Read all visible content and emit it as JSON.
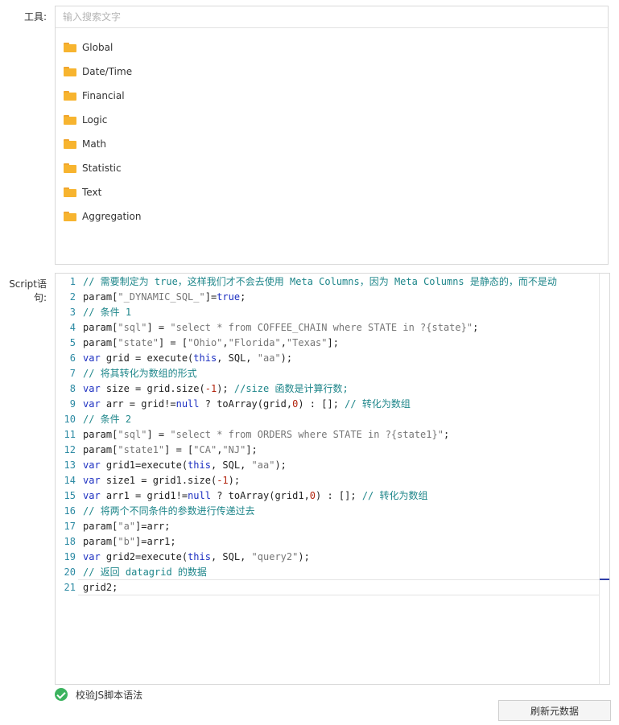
{
  "tools": {
    "label": "工具:",
    "search_placeholder": "输入搜索文字",
    "folders": [
      "Global",
      "Date/Time",
      "Financial",
      "Logic",
      "Math",
      "Statistic",
      "Text",
      "Aggregation"
    ]
  },
  "script": {
    "label": "Script语句:",
    "lines": [
      [
        [
          "cmt",
          "// 需要制定为 true，这样我们才不会去使用 Meta Columns，因为 Meta Columns 是静态的，而不是动"
        ]
      ],
      [
        [
          "p",
          "param["
        ],
        [
          "str",
          "\"_DYNAMIC_SQL_\""
        ],
        [
          "p",
          "]="
        ],
        [
          "kw",
          "true"
        ],
        [
          "p",
          ";"
        ]
      ],
      [
        [
          "cmt",
          "// 条件 1"
        ]
      ],
      [
        [
          "p",
          "param["
        ],
        [
          "str",
          "\"sql\""
        ],
        [
          "p",
          "] = "
        ],
        [
          "str",
          "\"select * from COFFEE_CHAIN where STATE in ?{state}\""
        ],
        [
          "p",
          ";"
        ]
      ],
      [
        [
          "p",
          "param["
        ],
        [
          "str",
          "\"state\""
        ],
        [
          "p",
          "] = ["
        ],
        [
          "str",
          "\"Ohio\""
        ],
        [
          "p",
          ","
        ],
        [
          "str",
          "\"Florida\""
        ],
        [
          "p",
          ","
        ],
        [
          "str",
          "\"Texas\""
        ],
        [
          "p",
          "];"
        ]
      ],
      [
        [
          "kw",
          "var"
        ],
        [
          "p",
          " grid = execute("
        ],
        [
          "kw",
          "this"
        ],
        [
          "p",
          ", SQL, "
        ],
        [
          "str",
          "\"aa\""
        ],
        [
          "p",
          ");"
        ]
      ],
      [
        [
          "cmt",
          "// 将其转化为数组的形式"
        ]
      ],
      [
        [
          "kw",
          "var"
        ],
        [
          "p",
          " size = grid.size("
        ],
        [
          "num",
          "-1"
        ],
        [
          "p",
          "); "
        ],
        [
          "cmt",
          "//size 函数是计算行数;"
        ]
      ],
      [
        [
          "kw",
          "var"
        ],
        [
          "p",
          " arr = grid!="
        ],
        [
          "kw",
          "null"
        ],
        [
          "p",
          " ? toArray(grid,"
        ],
        [
          "num",
          "0"
        ],
        [
          "p",
          ") : []; "
        ],
        [
          "cmt",
          "// 转化为数组"
        ]
      ],
      [
        [
          "cmt",
          "// 条件 2"
        ]
      ],
      [
        [
          "p",
          "param["
        ],
        [
          "str",
          "\"sql\""
        ],
        [
          "p",
          "] = "
        ],
        [
          "str",
          "\"select * from ORDERS where STATE in ?{state1}\""
        ],
        [
          "p",
          ";"
        ]
      ],
      [
        [
          "p",
          "param["
        ],
        [
          "str",
          "\"state1\""
        ],
        [
          "p",
          "] = ["
        ],
        [
          "str",
          "\"CA\""
        ],
        [
          "p",
          ","
        ],
        [
          "str",
          "\"NJ\""
        ],
        [
          "p",
          "];"
        ]
      ],
      [
        [
          "kw",
          "var"
        ],
        [
          "p",
          " grid1=execute("
        ],
        [
          "kw",
          "this"
        ],
        [
          "p",
          ", SQL, "
        ],
        [
          "str",
          "\"aa\""
        ],
        [
          "p",
          ");"
        ]
      ],
      [
        [
          "kw",
          "var"
        ],
        [
          "p",
          " size1 = grid1.size("
        ],
        [
          "num",
          "-1"
        ],
        [
          "p",
          ");"
        ]
      ],
      [
        [
          "kw",
          "var"
        ],
        [
          "p",
          " arr1 = grid1!="
        ],
        [
          "kw",
          "null"
        ],
        [
          "p",
          " ? toArray(grid1,"
        ],
        [
          "num",
          "0"
        ],
        [
          "p",
          ") : []; "
        ],
        [
          "cmt",
          "// 转化为数组"
        ]
      ],
      [
        [
          "cmt",
          "// 将两个不同条件的参数进行传递过去"
        ]
      ],
      [
        [
          "p",
          "param["
        ],
        [
          "str",
          "\"a\""
        ],
        [
          "p",
          "]=arr;"
        ]
      ],
      [
        [
          "p",
          "param["
        ],
        [
          "str",
          "\"b\""
        ],
        [
          "p",
          "]=arr1;"
        ]
      ],
      [
        [
          "kw",
          "var"
        ],
        [
          "p",
          " grid2=execute("
        ],
        [
          "kw",
          "this"
        ],
        [
          "p",
          ", SQL, "
        ],
        [
          "str",
          "\"query2\""
        ],
        [
          "p",
          ");"
        ]
      ],
      [
        [
          "cmt",
          "// 返回 datagrid 的数据"
        ]
      ],
      [
        [
          "p",
          "grid2;"
        ]
      ]
    ]
  },
  "validate": {
    "label": "校验JS脚本语法"
  },
  "refresh": {
    "label": "刷新元数据"
  }
}
